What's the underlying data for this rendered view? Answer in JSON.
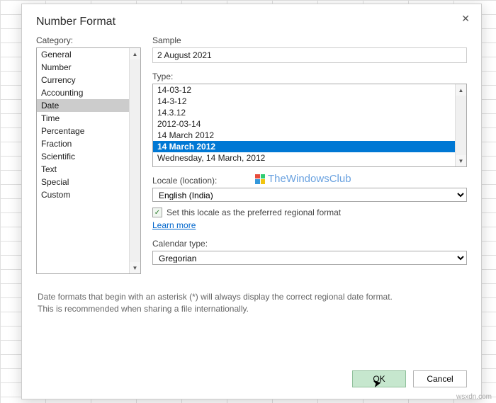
{
  "dialog": {
    "title": "Number Format",
    "category_label": "Category:",
    "categories": [
      "General",
      "Number",
      "Currency",
      "Accounting",
      "Date",
      "Time",
      "Percentage",
      "Fraction",
      "Scientific",
      "Text",
      "Special",
      "Custom"
    ],
    "selected_category": "Date",
    "sample_label": "Sample",
    "sample_value": "2 August 2021",
    "type_label": "Type:",
    "types": [
      "14-03-12",
      "14-3-12",
      "14.3.12",
      "2012-03-14",
      "14 March 2012",
      "14 March 2012",
      "Wednesday, 14 March, 2012"
    ],
    "selected_type_index": 5,
    "locale_label": "Locale (location):",
    "locale_value": "English (India)",
    "locale_checkbox_label": "Set this locale as the preferred regional format",
    "locale_checkbox_checked": true,
    "learn_more": "Learn more",
    "calendar_label": "Calendar type:",
    "calendar_value": "Gregorian",
    "helper_text_1": "Date formats that begin with an asterisk (*) will always display the correct regional date format.",
    "helper_text_2": "This is recommended when sharing a file internationally.",
    "ok_label": "OK",
    "cancel_label": "Cancel"
  },
  "watermark": "TheWindowsClub",
  "site": "wsxdn.com"
}
